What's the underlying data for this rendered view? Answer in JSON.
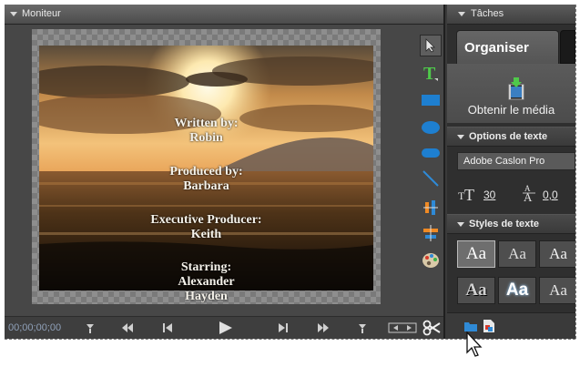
{
  "monitor": {
    "title": "Moniteur",
    "credits": [
      "Written by:",
      "Robin",
      "Produced by:",
      "Barbara",
      "Executive Producer:",
      "Keith",
      "Starring:",
      "Alexander",
      "Hayden"
    ],
    "timecode": "00;00;00;00",
    "tools": [
      "selection-arrow-icon",
      "text-tool-icon",
      "rectangle-icon",
      "ellipse-icon",
      "rounded-rectangle-icon",
      "line-icon",
      "align-icon",
      "distribute-icon",
      "color-palette-icon"
    ],
    "controls": [
      "set-in-point-icon",
      "rewind-icon",
      "step-back-icon",
      "play-icon",
      "step-forward-icon",
      "fast-forward-icon",
      "set-out-point-icon",
      "trim-icon",
      "split-scissors-icon"
    ]
  },
  "tasks": {
    "title": "Tâches",
    "tab_label": "Organiser",
    "get_media_label": "Obtenir le média",
    "text_options_label": "Options de texte",
    "font_name": "Adobe Caslon Pro",
    "font_size": "30",
    "leading": "0,0",
    "text_styles_label": "Styles de texte",
    "style_sample": "Aa"
  },
  "colors": {
    "panel_bg": "#474747",
    "accent_blue": "#2f8ad6",
    "text_tool_green": "#4fc94a"
  }
}
